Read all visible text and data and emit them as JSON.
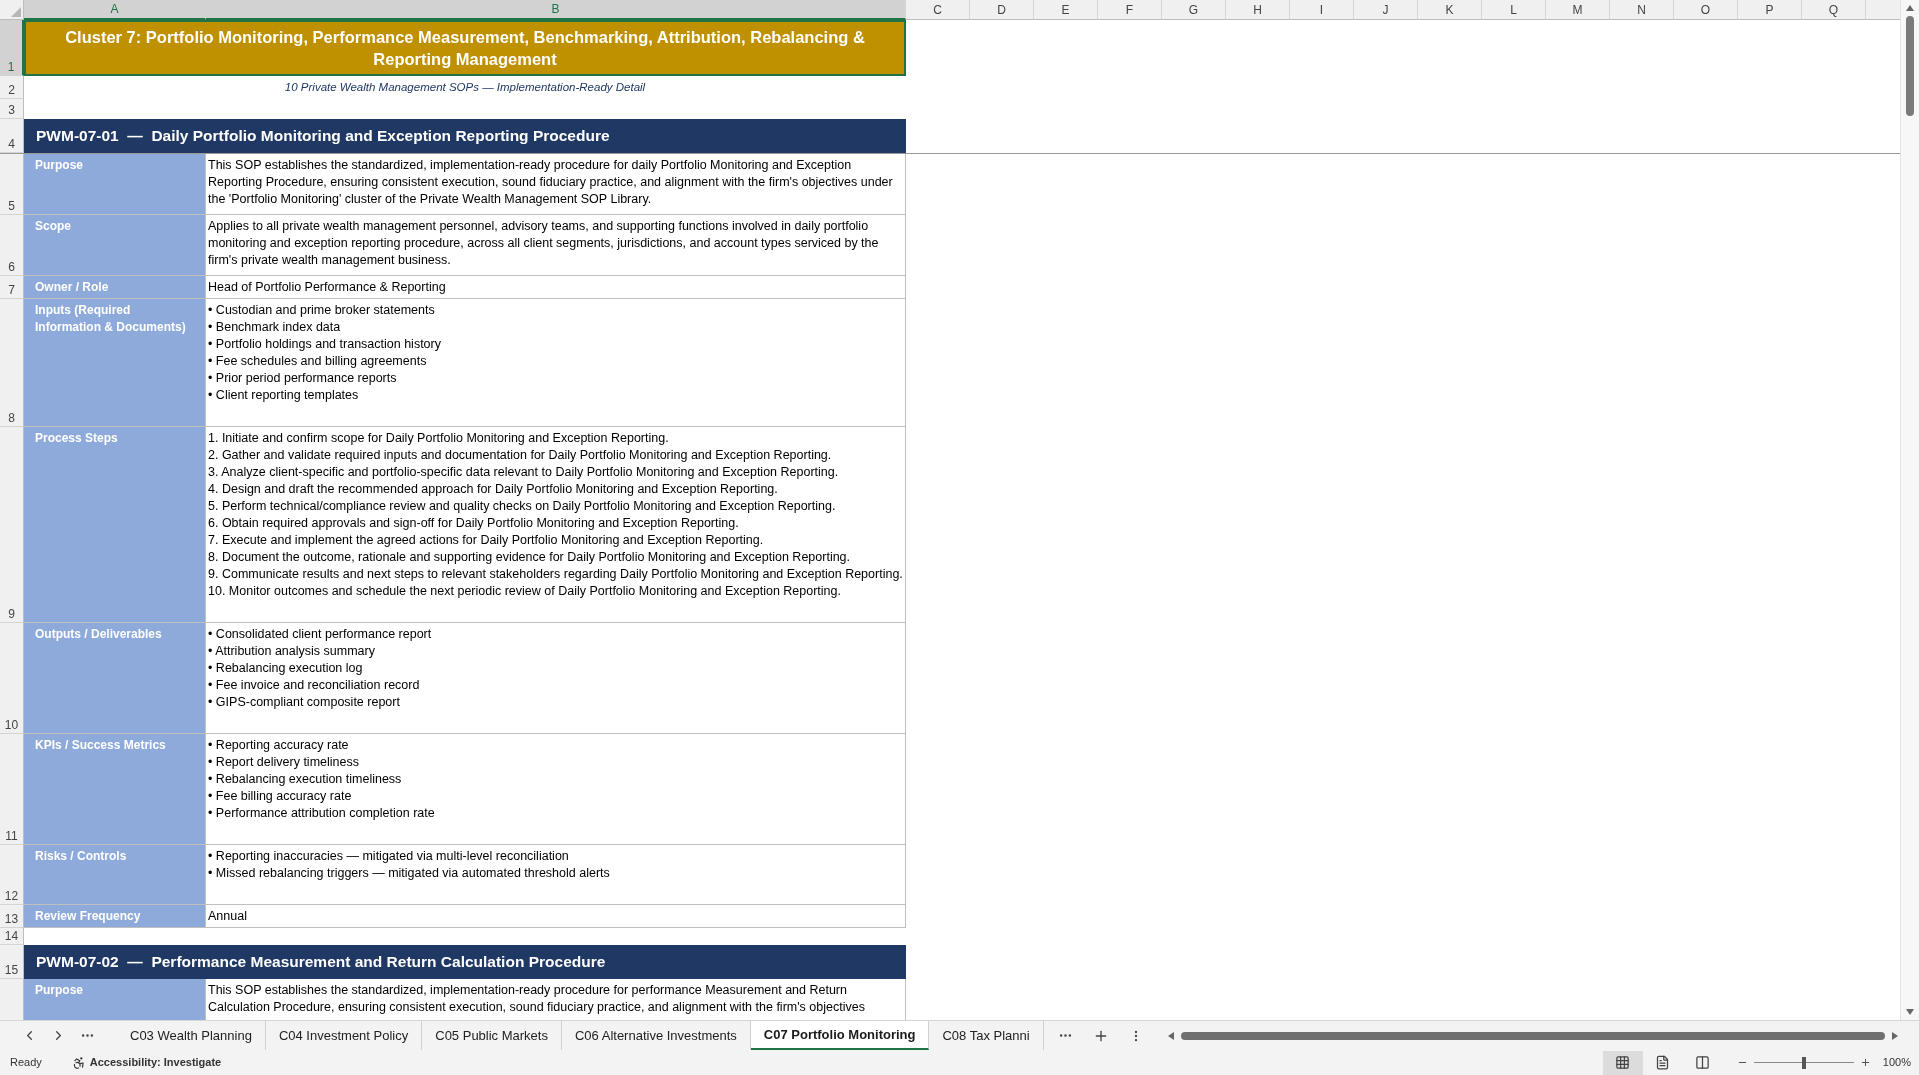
{
  "columns": [
    {
      "label": "A",
      "selected": true
    },
    {
      "label": "B",
      "selected": true
    },
    {
      "label": "C",
      "selected": false
    },
    {
      "label": "D",
      "selected": false
    },
    {
      "label": "E",
      "selected": false
    },
    {
      "label": "F",
      "selected": false
    },
    {
      "label": "G",
      "selected": false
    },
    {
      "label": "H",
      "selected": false
    },
    {
      "label": "I",
      "selected": false
    },
    {
      "label": "J",
      "selected": false
    },
    {
      "label": "K",
      "selected": false
    },
    {
      "label": "L",
      "selected": false
    },
    {
      "label": "M",
      "selected": false
    },
    {
      "label": "N",
      "selected": false
    },
    {
      "label": "O",
      "selected": false
    },
    {
      "label": "P",
      "selected": false
    },
    {
      "label": "Q",
      "selected": false
    }
  ],
  "rows": [
    {
      "kind": "title",
      "number": "1",
      "selected": true,
      "text": "Cluster 7: Portfolio Monitoring, Performance Measurement, Benchmarking, Attribution, Rebalancing & Reporting Management"
    },
    {
      "kind": "subtitle",
      "number": "2",
      "selected": false,
      "text": "10 Private Wealth Management SOPs — Implementation-Ready Detail"
    },
    {
      "kind": "blank",
      "number": "3",
      "selected": false
    },
    {
      "kind": "section",
      "number": "4",
      "selected": false,
      "text": "PWM-07-01  —  Daily Portfolio Monitoring and Exception Reporting Procedure"
    },
    {
      "kind": "field",
      "number": "5",
      "selected": false,
      "label": "Purpose",
      "lines": [
        "This SOP establishes the standardized, implementation-ready procedure for daily Portfolio Monitoring and Exception Reporting Procedure, ensuring consistent execution, sound fiduciary practice, and alignment with the firm's objectives under the 'Portfolio Monitoring' cluster of the Private Wealth Management SOP Library."
      ]
    },
    {
      "kind": "field",
      "number": "6",
      "selected": false,
      "label": "Scope",
      "lines": [
        "Applies to all private wealth management personnel, advisory teams, and supporting functions involved in daily portfolio monitoring and exception reporting procedure, across all client segments, jurisdictions, and account types serviced by the firm's private wealth management business."
      ]
    },
    {
      "kind": "field",
      "number": "7",
      "selected": false,
      "label": "Owner / Role",
      "lines": [
        "Head of Portfolio Performance & Reporting"
      ]
    },
    {
      "kind": "field",
      "number": "8",
      "selected": false,
      "label": "Inputs (Required Information & Documents)",
      "lines": [
        "• Custodian and prime broker statements",
        "• Benchmark index data",
        "• Portfolio holdings and transaction history",
        "• Fee schedules and billing agreements",
        "• Prior period performance reports",
        "• Client reporting templates"
      ]
    },
    {
      "kind": "field",
      "number": "9",
      "selected": false,
      "label": "Process Steps",
      "lines": [
        "1. Initiate and confirm scope for Daily Portfolio Monitoring and Exception Reporting.",
        "2. Gather and validate required inputs and documentation for Daily Portfolio Monitoring and Exception Reporting.",
        "3. Analyze client-specific and portfolio-specific data relevant to Daily Portfolio Monitoring and Exception Reporting.",
        "4. Design and draft the recommended approach for Daily Portfolio Monitoring and Exception Reporting.",
        "5. Perform technical/compliance review and quality checks on Daily Portfolio Monitoring and Exception Reporting.",
        "6. Obtain required approvals and sign-off for Daily Portfolio Monitoring and Exception Reporting.",
        "7. Execute and implement the agreed actions for Daily Portfolio Monitoring and Exception Reporting.",
        "8. Document the outcome, rationale and supporting evidence for Daily Portfolio Monitoring and Exception Reporting.",
        "9. Communicate results and next steps to relevant stakeholders regarding Daily Portfolio Monitoring and Exception Reporting.",
        "10. Monitor outcomes and schedule the next periodic review of Daily Portfolio Monitoring and Exception Reporting."
      ]
    },
    {
      "kind": "field",
      "number": "10",
      "selected": false,
      "label": "Outputs / Deliverables",
      "lines": [
        "• Consolidated client performance report",
        "• Attribution analysis summary",
        "• Rebalancing execution log",
        "• Fee invoice and reconciliation record",
        "• GIPS-compliant composite report"
      ]
    },
    {
      "kind": "field",
      "number": "11",
      "selected": false,
      "label": "KPIs / Success Metrics",
      "lines": [
        "• Reporting accuracy rate",
        "• Report delivery timeliness",
        "• Rebalancing execution timeliness",
        "• Fee billing accuracy rate",
        "• Performance attribution completion rate"
      ]
    },
    {
      "kind": "field",
      "number": "12",
      "selected": false,
      "label": "Risks / Controls",
      "lines": [
        "• Reporting inaccuracies — mitigated via multi-level reconciliation",
        "• Missed rebalancing triggers — mitigated via automated threshold alerts"
      ]
    },
    {
      "kind": "field",
      "number": "13",
      "selected": false,
      "label": "Review Frequency",
      "lines": [
        "Annual"
      ]
    },
    {
      "kind": "spacer",
      "number": "14",
      "selected": false
    },
    {
      "kind": "section",
      "number": "15",
      "selected": false,
      "text": "PWM-07-02  —  Performance Measurement and Return Calculation Procedure"
    },
    {
      "kind": "field",
      "selected": false,
      "label": "Purpose",
      "lines": [
        "This SOP establishes the standardized, implementation-ready procedure for performance Measurement and Return Calculation Procedure, ensuring consistent execution, sound fiduciary practice, and alignment with the firm's objectives"
      ]
    }
  ],
  "sheet_tabs": [
    {
      "label": "C03 Wealth Planning",
      "selected": false
    },
    {
      "label": "C04 Investment Policy",
      "selected": false
    },
    {
      "label": "C05 Public Markets",
      "selected": false
    },
    {
      "label": "C06 Alternative Investments",
      "selected": false
    },
    {
      "label": "C07 Portfolio Monitoring",
      "selected": true
    },
    {
      "label": "C08 Tax Planni",
      "selected": false
    }
  ],
  "status_bar": {
    "mode": "Ready",
    "accessibility": "Accessibility: Investigate",
    "views": [
      {
        "kind": "normal",
        "selected": true
      },
      {
        "kind": "page-layout",
        "selected": false
      },
      {
        "kind": "page-break",
        "selected": false
      }
    ],
    "zoom": {
      "level": 0.5,
      "reading": "100%"
    }
  }
}
